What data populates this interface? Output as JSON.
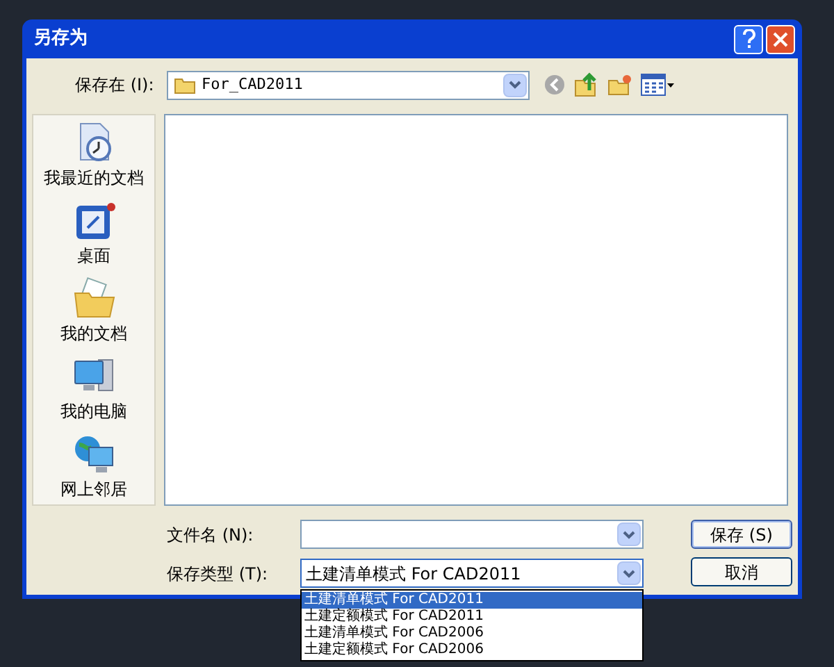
{
  "window": {
    "title": "另存为"
  },
  "save_in": {
    "label": "保存在 (I):",
    "value": "For_CAD2011"
  },
  "places": [
    {
      "label": "我最近的文档",
      "kind": "recent"
    },
    {
      "label": "桌面",
      "kind": "desktop"
    },
    {
      "label": "我的文档",
      "kind": "documents"
    },
    {
      "label": "我的电脑",
      "kind": "computer"
    },
    {
      "label": "网上邻居",
      "kind": "network"
    }
  ],
  "file_name": {
    "label": "文件名 (N):"
  },
  "save_type": {
    "label": "保存类型 (T):",
    "value": "土建清单模式 For CAD2011",
    "expanded": true,
    "options": [
      {
        "label": "土建清单模式 For CAD2011",
        "selected": true
      },
      {
        "label": "土建定额模式 For CAD2011",
        "selected": false
      },
      {
        "label": "土建清单模式 For CAD2006",
        "selected": false
      },
      {
        "label": "土建定额模式 For CAD2006",
        "selected": false
      }
    ]
  },
  "buttons": [
    {
      "label": "保存 (S)",
      "default": true
    },
    {
      "label": "取消",
      "default": false
    }
  ]
}
